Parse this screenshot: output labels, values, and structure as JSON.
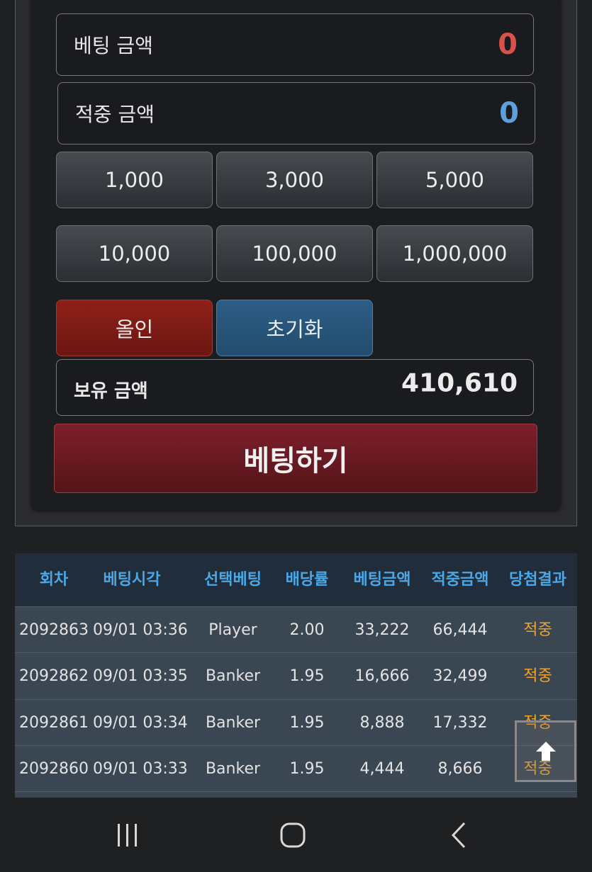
{
  "bet_panel": {
    "bet_amount_label": "베팅 금액",
    "bet_amount_value": "0",
    "win_amount_label": "적중 금액",
    "win_amount_value": "0",
    "chips": [
      "1,000",
      "3,000",
      "5,000",
      "10,000",
      "100,000",
      "1,000,000"
    ],
    "allin_label": "올인",
    "reset_label": "초기화",
    "balance_label": "보유 금액",
    "balance_value": "410,610",
    "bet_button_label": "베팅하기"
  },
  "history": {
    "headers": [
      "회차",
      "베팅시각",
      "선택베팅",
      "배당률",
      "베팅금액",
      "적중금액",
      "당첨결과"
    ],
    "rows": [
      [
        "2092863",
        "09/01 03:36",
        "Player",
        "2.00",
        "33,222",
        "66,444",
        "적중"
      ],
      [
        "2092862",
        "09/01 03:35",
        "Banker",
        "1.95",
        "16,666",
        "32,499",
        "적중"
      ],
      [
        "2092861",
        "09/01 03:34",
        "Banker",
        "1.95",
        "8,888",
        "17,332",
        "적중"
      ],
      [
        "2092860",
        "09/01 03:33",
        "Banker",
        "1.95",
        "4,444",
        "8,666",
        "적중"
      ]
    ]
  },
  "icons": {
    "scroll_top": "arrow-up-icon",
    "nav_recent": "recent-apps-icon",
    "nav_home": "home-icon",
    "nav_back": "back-icon"
  },
  "colors": {
    "bet_amount_value": "#d9534a",
    "win_amount_value": "#5ea0db",
    "header_text": "#4aa8e8",
    "result_text": "#f0a329"
  }
}
